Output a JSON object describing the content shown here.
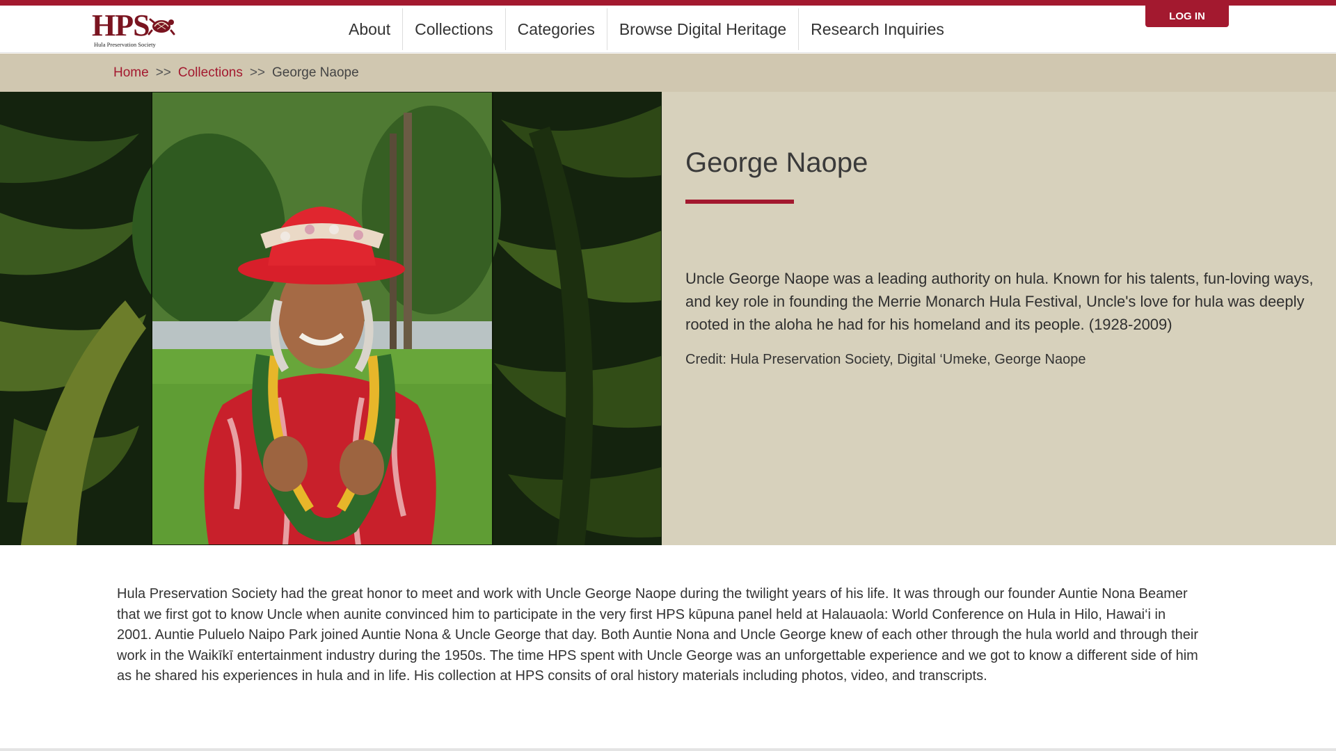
{
  "brand": {
    "logo_text": "HPS",
    "logo_subtitle": "Hula Preservation Society"
  },
  "nav": {
    "items": [
      "About",
      "Collections",
      "Categories",
      "Browse Digital Heritage",
      "Research Inquiries"
    ],
    "login_label": "LOG IN"
  },
  "breadcrumb": {
    "home": "Home",
    "collections": "Collections",
    "current": "George Naope",
    "separator": ">>"
  },
  "profile": {
    "name": "George Naope",
    "description": "Uncle George Naope was a leading authority on hula. Known for his talents, fun-loving ways, and key role in founding the Merrie Monarch Hula Festival, Uncle's love for hula was deeply rooted in the aloha he had for his homeland and its people. (1928-2009)",
    "credit": "Credit: Hula Preservation Society, Digital ‘Umeke, George Naope"
  },
  "story": {
    "text": "Hula Preservation Society had the great honor to meet and work with Uncle George Naope during the twilight years of his life. It was through our founder Auntie Nona Beamer that we first got to know Uncle when aunite convinced him to participate in the very first HPS kūpuna panel held at Halauaola: World Conference on Hula in Hilo, Hawai‘i in 2001. Auntie Puluelo Naipo Park joined Auntie Nona & Uncle George that day. Both Auntie Nona and Uncle George knew of each other through the hula world and through their work in the Waikīkī entertainment industry during the 1950s. The time HPS spent with Uncle George was an unforgettable experience and we got to know a different side of him as he shared his experiences in hula and in life. His collection at HPS consits of oral history materials including photos, video, and transcripts."
  },
  "colors": {
    "accent": "#a3192f",
    "breadcrumb_bg": "#d0c7b0",
    "info_bg": "#d7d1bc"
  }
}
